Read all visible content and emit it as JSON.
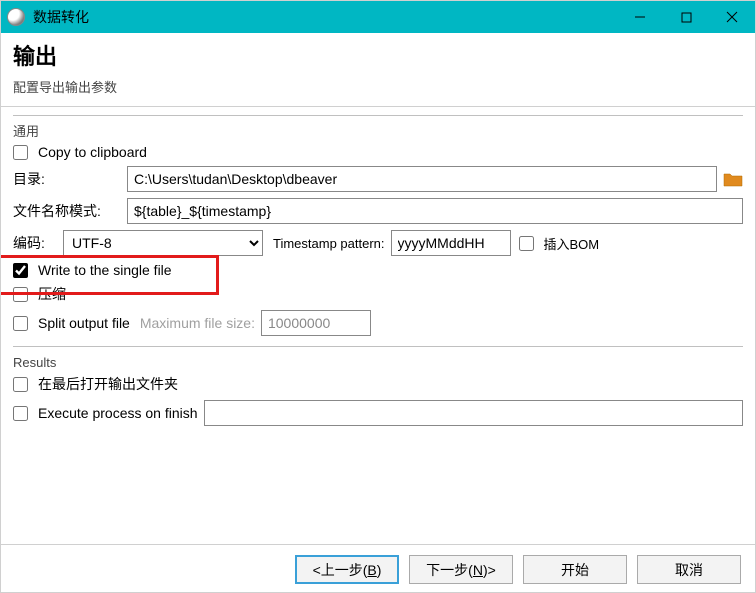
{
  "window": {
    "title": "数据转化"
  },
  "header": {
    "title": "输出",
    "subtitle": "配置导出输出参数"
  },
  "general": {
    "legend": "通用",
    "copy_clipboard_label": "Copy to clipboard",
    "copy_clipboard_checked": false,
    "dir_label": "目录:",
    "dir_value": "C:\\Users\\tudan\\Desktop\\dbeaver",
    "filepattern_label": "文件名称模式:",
    "filepattern_value": "${table}_${timestamp}",
    "encoding_label": "编码:",
    "encoding_value": "UTF-8",
    "timestamp_label": "Timestamp pattern:",
    "timestamp_value": "yyyyMMddHH",
    "insert_bom_label": "插入BOM",
    "insert_bom_checked": false,
    "single_file_label": "Write to the single file",
    "single_file_checked": true,
    "compress_label": "压缩",
    "compress_checked": false,
    "split_label": "Split output file",
    "split_checked": false,
    "split_size_label": "Maximum file size:",
    "split_size_value": "10000000"
  },
  "results": {
    "legend": "Results",
    "open_folder_label": "在最后打开输出文件夹",
    "open_folder_checked": false,
    "exec_finish_label": "Execute process on finish",
    "exec_finish_checked": false,
    "exec_finish_value": ""
  },
  "footer": {
    "back_prefix": "<上一步(",
    "back_hotkey": "B",
    "back_suffix": ")",
    "next_prefix": "下一步(",
    "next_hotkey": "N",
    "next_suffix": ")>",
    "start": "开始",
    "cancel": "取消"
  }
}
